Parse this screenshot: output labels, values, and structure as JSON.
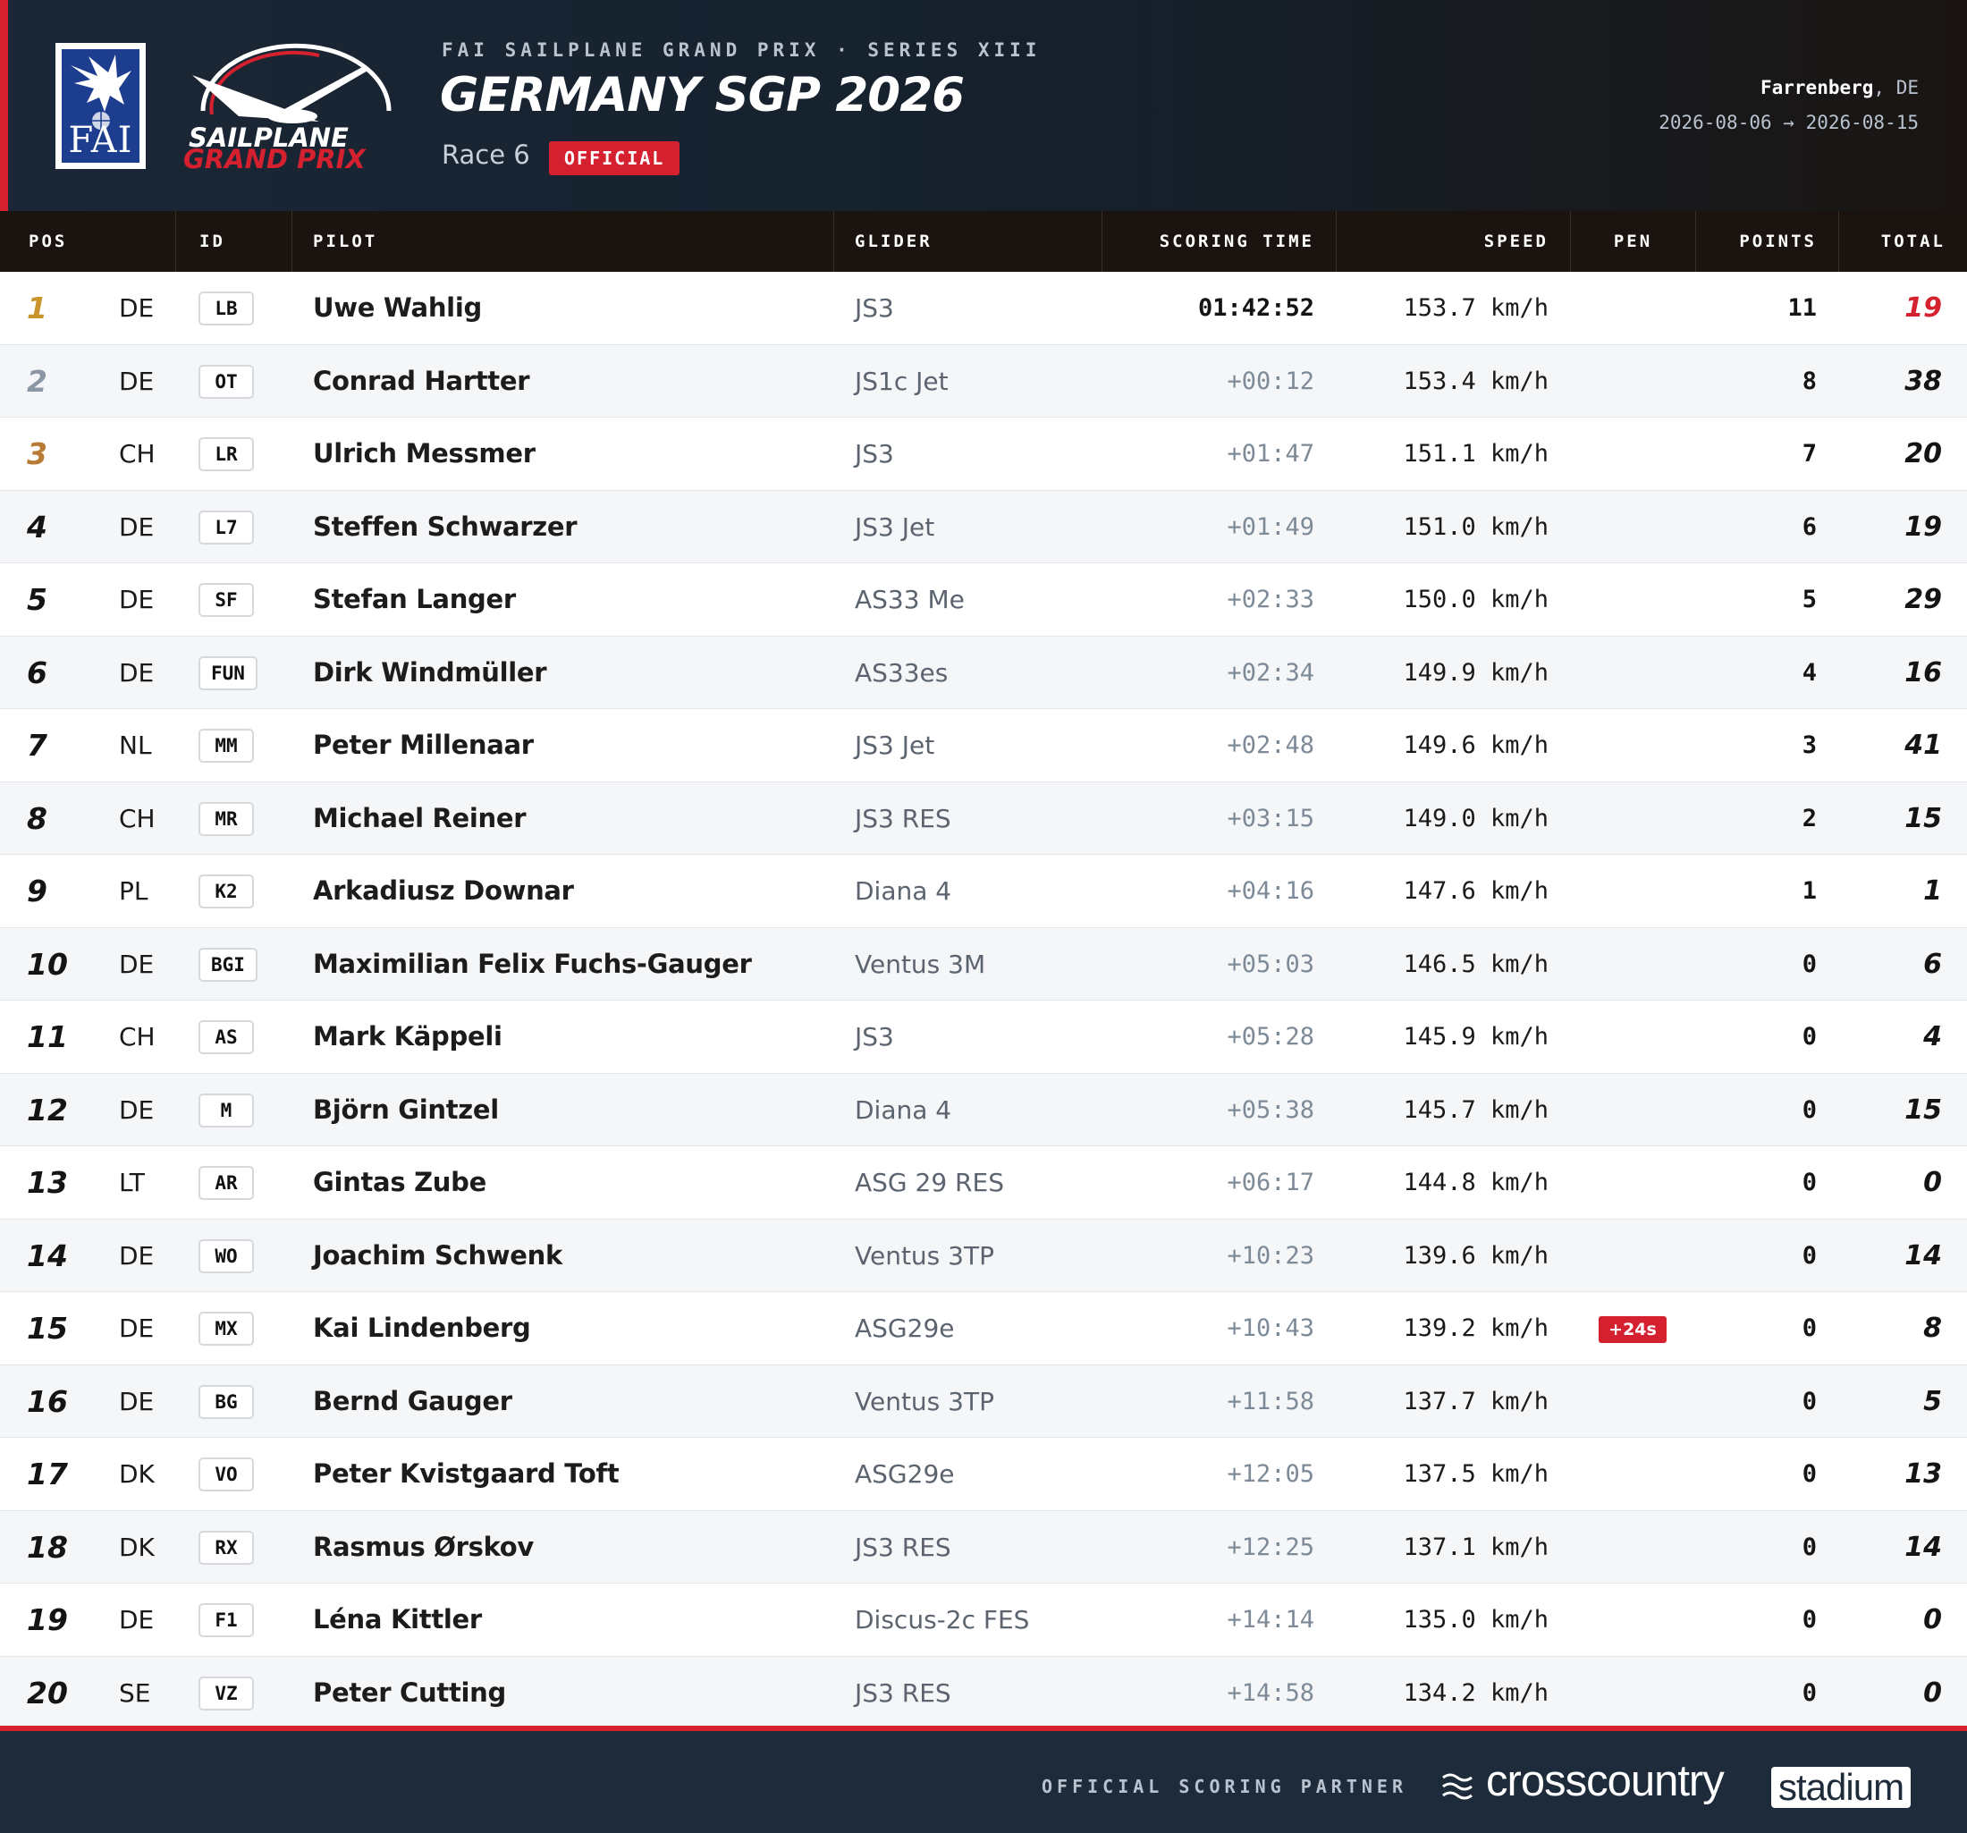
{
  "header": {
    "kicker": "FAI SAILPLANE GRAND PRIX · SERIES XIII",
    "title": "GERMANY SGP 2026",
    "race": "Race 6",
    "status": "OFFICIAL",
    "venue_city": "Farrenberg",
    "venue_country": ", DE",
    "dates": "2026-08-06 → 2026-08-15",
    "fai_logo_text": "FAI",
    "sgp_logo_line1": "SAILPLANE",
    "sgp_logo_line2": "GRAND PRIX"
  },
  "columns": {
    "pos": "POS",
    "id": "ID",
    "pilot": "PILOT",
    "glider": "GLIDER",
    "scoring_time": "SCORING TIME",
    "speed": "SPEED",
    "pen": "PEN",
    "points": "POINTS",
    "total": "TOTAL"
  },
  "rows": [
    {
      "pos": "1",
      "nat": "DE",
      "id": "LB",
      "pilot": "Uwe Wahlig",
      "glider": "JS3",
      "time": "01:42:52",
      "speed": "153.7 km/h",
      "pen": "",
      "points": "11",
      "total": "19"
    },
    {
      "pos": "2",
      "nat": "DE",
      "id": "OT",
      "pilot": "Conrad Hartter",
      "glider": "JS1c Jet",
      "time": "+00:12",
      "speed": "153.4 km/h",
      "pen": "",
      "points": "8",
      "total": "38"
    },
    {
      "pos": "3",
      "nat": "CH",
      "id": "LR",
      "pilot": "Ulrich Messmer",
      "glider": "JS3",
      "time": "+01:47",
      "speed": "151.1 km/h",
      "pen": "",
      "points": "7",
      "total": "20"
    },
    {
      "pos": "4",
      "nat": "DE",
      "id": "L7",
      "pilot": "Steffen Schwarzer",
      "glider": "JS3 Jet",
      "time": "+01:49",
      "speed": "151.0 km/h",
      "pen": "",
      "points": "6",
      "total": "19"
    },
    {
      "pos": "5",
      "nat": "DE",
      "id": "SF",
      "pilot": "Stefan Langer",
      "glider": "AS33 Me",
      "time": "+02:33",
      "speed": "150.0 km/h",
      "pen": "",
      "points": "5",
      "total": "29"
    },
    {
      "pos": "6",
      "nat": "DE",
      "id": "FUN",
      "pilot": "Dirk Windmüller",
      "glider": "AS33es",
      "time": "+02:34",
      "speed": "149.9 km/h",
      "pen": "",
      "points": "4",
      "total": "16"
    },
    {
      "pos": "7",
      "nat": "NL",
      "id": "MM",
      "pilot": "Peter Millenaar",
      "glider": "JS3 Jet",
      "time": "+02:48",
      "speed": "149.6 km/h",
      "pen": "",
      "points": "3",
      "total": "41"
    },
    {
      "pos": "8",
      "nat": "CH",
      "id": "MR",
      "pilot": "Michael Reiner",
      "glider": "JS3 RES",
      "time": "+03:15",
      "speed": "149.0 km/h",
      "pen": "",
      "points": "2",
      "total": "15"
    },
    {
      "pos": "9",
      "nat": "PL",
      "id": "K2",
      "pilot": "Arkadiusz Downar",
      "glider": "Diana 4",
      "time": "+04:16",
      "speed": "147.6 km/h",
      "pen": "",
      "points": "1",
      "total": "1"
    },
    {
      "pos": "10",
      "nat": "DE",
      "id": "BGI",
      "pilot": "Maximilian Felix Fuchs-Gauger",
      "glider": "Ventus 3M",
      "time": "+05:03",
      "speed": "146.5 km/h",
      "pen": "",
      "points": "0",
      "total": "6"
    },
    {
      "pos": "11",
      "nat": "CH",
      "id": "AS",
      "pilot": "Mark Käppeli",
      "glider": "JS3",
      "time": "+05:28",
      "speed": "145.9 km/h",
      "pen": "",
      "points": "0",
      "total": "4"
    },
    {
      "pos": "12",
      "nat": "DE",
      "id": "M",
      "pilot": "Björn Gintzel",
      "glider": "Diana 4",
      "time": "+05:38",
      "speed": "145.7 km/h",
      "pen": "",
      "points": "0",
      "total": "15"
    },
    {
      "pos": "13",
      "nat": "LT",
      "id": "AR",
      "pilot": "Gintas Zube",
      "glider": "ASG 29 RES",
      "time": "+06:17",
      "speed": "144.8 km/h",
      "pen": "",
      "points": "0",
      "total": "0"
    },
    {
      "pos": "14",
      "nat": "DE",
      "id": "WO",
      "pilot": "Joachim Schwenk",
      "glider": "Ventus 3TP",
      "time": "+10:23",
      "speed": "139.6 km/h",
      "pen": "",
      "points": "0",
      "total": "14"
    },
    {
      "pos": "15",
      "nat": "DE",
      "id": "MX",
      "pilot": "Kai Lindenberg",
      "glider": "ASG29e",
      "time": "+10:43",
      "speed": "139.2 km/h",
      "pen": "+24s",
      "points": "0",
      "total": "8"
    },
    {
      "pos": "16",
      "nat": "DE",
      "id": "BG",
      "pilot": "Bernd Gauger",
      "glider": "Ventus 3TP",
      "time": "+11:58",
      "speed": "137.7 km/h",
      "pen": "",
      "points": "0",
      "total": "5"
    },
    {
      "pos": "17",
      "nat": "DK",
      "id": "VO",
      "pilot": "Peter Kvistgaard Toft",
      "glider": "ASG29e",
      "time": "+12:05",
      "speed": "137.5 km/h",
      "pen": "",
      "points": "0",
      "total": "13"
    },
    {
      "pos": "18",
      "nat": "DK",
      "id": "RX",
      "pilot": "Rasmus Ørskov",
      "glider": "JS3 RES",
      "time": "+12:25",
      "speed": "137.1 km/h",
      "pen": "",
      "points": "0",
      "total": "14"
    },
    {
      "pos": "19",
      "nat": "DE",
      "id": "F1",
      "pilot": "Léna Kittler",
      "glider": "Discus-2c FES",
      "time": "+14:14",
      "speed": "135.0 km/h",
      "pen": "",
      "points": "0",
      "total": "0"
    },
    {
      "pos": "20",
      "nat": "SE",
      "id": "VZ",
      "pilot": "Peter Cutting",
      "glider": "JS3 RES",
      "time": "+14:58",
      "speed": "134.2 km/h",
      "pen": "",
      "points": "0",
      "total": "0"
    }
  ],
  "footer": {
    "partner_label": "OFFICIAL SCORING PARTNER",
    "brand_word": "crosscountry",
    "brand_box": "stadium"
  },
  "colors": {
    "accent_red": "#d4202f",
    "header_bg": "#1b2736",
    "table_header_bg": "#1a130f",
    "gold": "#c9952b",
    "silver": "#8c97a6",
    "bronze": "#b87b35"
  },
  "icons": [
    "fai-eagle-icon",
    "sailplane-glider-icon",
    "crosscountry-wave-icon"
  ]
}
